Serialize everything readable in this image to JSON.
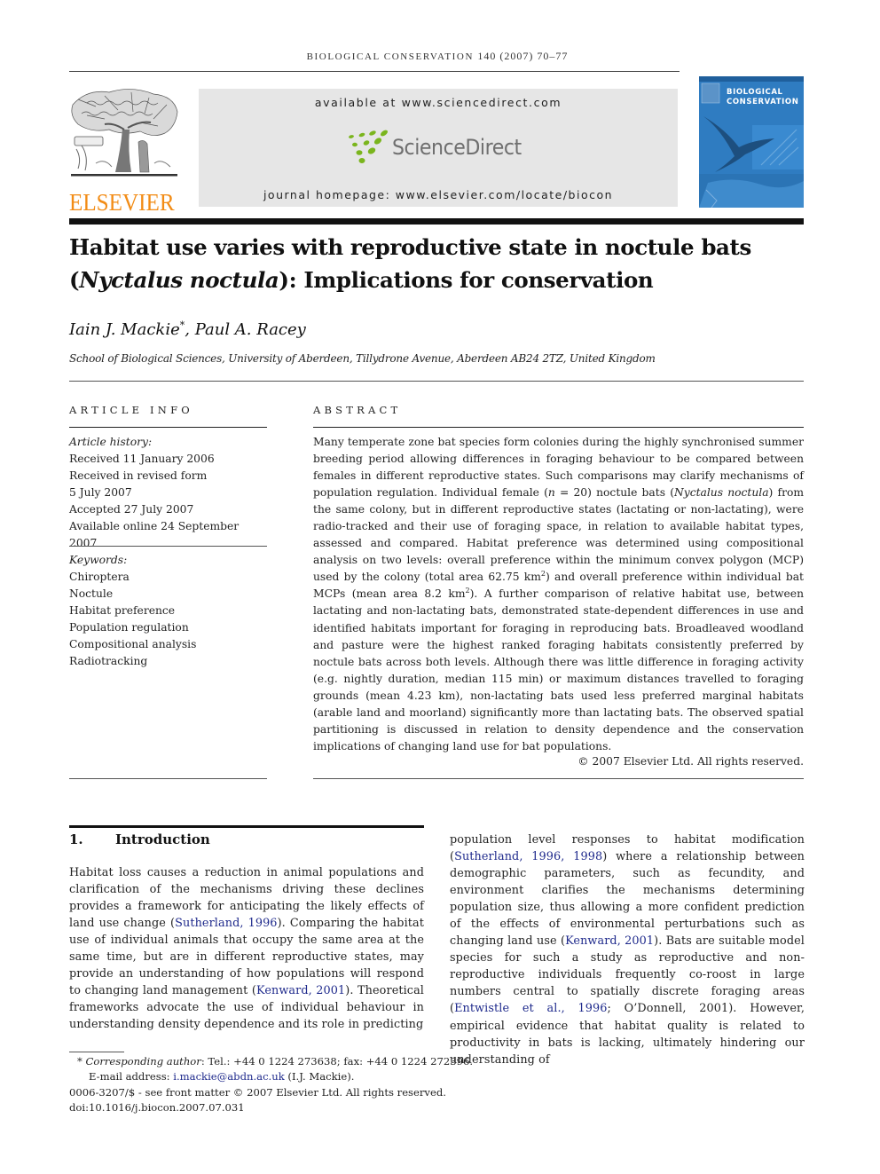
{
  "header": {
    "running_head_text": "BIOLOGICAL CONSERVATION",
    "running_head_numbers": "140 (2007) 70–77",
    "publisher_logo_text": "ELSEVIER",
    "sciencedirect_available": "available at www.sciencedirect.com",
    "sciencedirect_logo_text": "ScienceDirect",
    "journal_homepage": "journal homepage: www.elsevier.com/locate/biocon",
    "cover_title_line1": "BIOLOGICAL",
    "cover_title_line2": "CONSERVATION",
    "colors": {
      "elsevier_orange": "#f28c16",
      "sciencedirect_green": "#7ab51d",
      "sciencedirect_gray": "#6f6f6f",
      "cover_blue": "#2f7cc1",
      "link_blue": "#1f2a8c",
      "banner_gray": "#e6e6e6"
    }
  },
  "article": {
    "title_line1": "Habitat use varies with reproductive state in noctule bats",
    "title_species": "Nyctalus noctula",
    "title_rest": "): Implications for conservation",
    "authors": {
      "author1": "Iain J. Mackie",
      "author1_mark": "*",
      "separator": ", ",
      "author2": "Paul A. Racey"
    },
    "affiliation": "School of Biological Sciences, University of Aberdeen, Tillydrone Avenue, Aberdeen AB24 2TZ, United Kingdom"
  },
  "article_info": {
    "heading": "ARTICLE INFO",
    "history_label": "Article history:",
    "history": [
      "Received 11 January 2006",
      "Received in revised form",
      "5 July 2007",
      "Accepted 27 July 2007",
      "Available online 24 September 2007"
    ],
    "keywords_label": "Keywords:",
    "keywords": [
      "Chiroptera",
      "Noctule",
      "Habitat preference",
      "Population regulation",
      "Compositional analysis",
      "Radiotracking"
    ]
  },
  "abstract": {
    "heading": "ABSTRACT",
    "p1": "Many temperate zone bat species form colonies during the highly synchronised summer breeding period allowing differences in foraging behaviour to be compared between females in different reproductive states. Such comparisons may clarify mechanisms of population regulation. Individual female (",
    "n_var": "n",
    "p2": " = 20) noctule bats (",
    "species": "Nyctalus noctula",
    "p3": ") from the same colony, but in different reproductive states (lactating or non-lactating), were radio-tracked and their use of foraging space, in relation to available habitat types, assessed and compared. Habitat preference was determined using compositional analysis on two levels: overall preference within the minimum convex polygon (MCP) used by the colony (total area 62.75 km",
    "sup1": "2",
    "p4": ") and overall preference within individual bat MCPs (mean area 8.2 km",
    "sup2": "2",
    "p5": "). A further comparison of relative habitat use, between lactating and non-lactating bats, demonstrated state-dependent differences in use and identified habitats important for foraging in reproducing bats. Broadleaved woodland and pasture were the highest ranked foraging habitats consistently preferred by noctule bats across both levels. Although there was little difference in foraging activity (e.g. nightly duration, median 115 min) or maximum distances travelled to foraging grounds (mean 4.23 km), non-lactating bats used less preferred marginal habitats (arable land and moorland) significantly more than lactating bats. The observed spatial partitioning is discussed in relation to density dependence and the conservation implications of changing land use for bat populations.",
    "copyright": "© 2007 Elsevier Ltd. All rights reserved."
  },
  "introduction": {
    "number": "1.",
    "heading": "Introduction",
    "left": {
      "t1": "Habitat loss causes a reduction in animal populations and clarification of the mechanisms driving these declines provides a framework for anticipating the likely effects of land use change (",
      "c1": "Sutherland, 1996",
      "t2": "). Comparing the habitat use of individual animals that occupy the same area at the same time, but are in different reproductive states, may provide an understanding of how populations will respond to changing land management (",
      "c2": "Kenward, 2001",
      "t3": "). Theoretical frameworks advocate the use of individual behaviour in understanding density dependence and its role in predicting"
    },
    "right": {
      "t1": "population level responses to habitat modification (",
      "c1": "Sutherland, 1996, 1998",
      "t2": ") where a relationship between demographic parameters, such as fecundity, and environment clarifies the mechanisms determining population size, thus allowing a more confident prediction of the effects of environmental perturbations such as changing land use (",
      "c2": "Kenward, 2001",
      "t3": "). Bats are suitable model species for such a study as reproductive and non-reproductive individuals frequently co-roost in large numbers central to spatially discrete foraging areas (",
      "c3": "Entwistle et al., 1996",
      "t4": "; O’Donnell, 2001). However, empirical evidence that habitat quality is related to productivity in bats is lacking, ultimately hindering our understanding of"
    }
  },
  "footnotes": {
    "mark": "*",
    "corresponding_label": "Corresponding author",
    "corresponding_text": ": Tel.: +44 0 1224 273638; fax: +44 0 1224 272396.",
    "email_label": "E-mail address: ",
    "email": "i.mackie@abdn.ac.uk",
    "email_suffix": " (I.J. Mackie).",
    "front_matter": "0006-3207/$ - see front matter © 2007 Elsevier Ltd. All rights reserved.",
    "doi": "doi:10.1016/j.biocon.2007.07.031"
  }
}
